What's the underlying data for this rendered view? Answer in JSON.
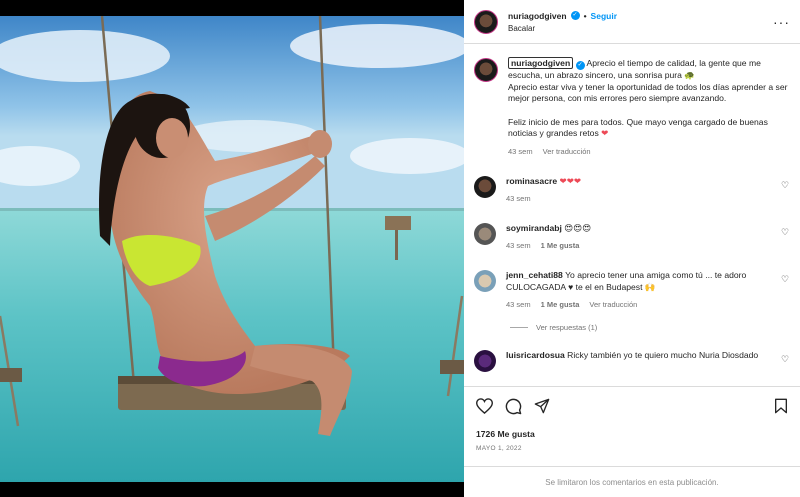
{
  "post": {
    "username": "nuriagodgiven",
    "follow_label": "Seguir",
    "separator": "•",
    "location": "Bacalar",
    "more_icon": "more-dots-icon"
  },
  "caption": {
    "username": "nuriagodgiven",
    "text1": "Aprecio el tiempo de calidad, la gente que me escucha, un abrazo sincero, una sonrisa pura 🐢",
    "text2": "Aprecio estar viva y tener la oportunidad de todos los días aprender a ser mejor persona, con mis errores pero siempre avanzando.",
    "text3": "Feliz inicio de mes para todos. Que mayo venga cargado de buenas noticias y grandes retos",
    "heart": "❤",
    "time": "43 sem",
    "translate": "Ver traducción"
  },
  "comments": [
    {
      "username": "rominasacre",
      "text": "❤❤❤",
      "time": "43 sem",
      "likes": "",
      "reply_note": ""
    },
    {
      "username": "soymirandabj",
      "text": "😍😍😍",
      "time": "43 sem",
      "likes": "1 Me gusta",
      "reply_note": ""
    },
    {
      "username": "jenn_cehati88",
      "text": "Yo aprecio tener una amiga como tú ... te adoro CULOCAGADA ♥ te el en Budapest 🙌",
      "time": "43 sem",
      "likes": "1 Me gusta",
      "translate": "Ver traducción"
    },
    {
      "username": "luisricardosua",
      "text": "Ricky también yo te quiero mucho Nuria Diosdado",
      "time": "",
      "likes": "",
      "reply_note": ""
    }
  ],
  "view_replies": "Ver respuestas (1)",
  "likes_count": "1726 Me gusta",
  "date": "MAYO 1, 2022",
  "comments_disabled": "Se limitaron los comentarios en esta publicación."
}
